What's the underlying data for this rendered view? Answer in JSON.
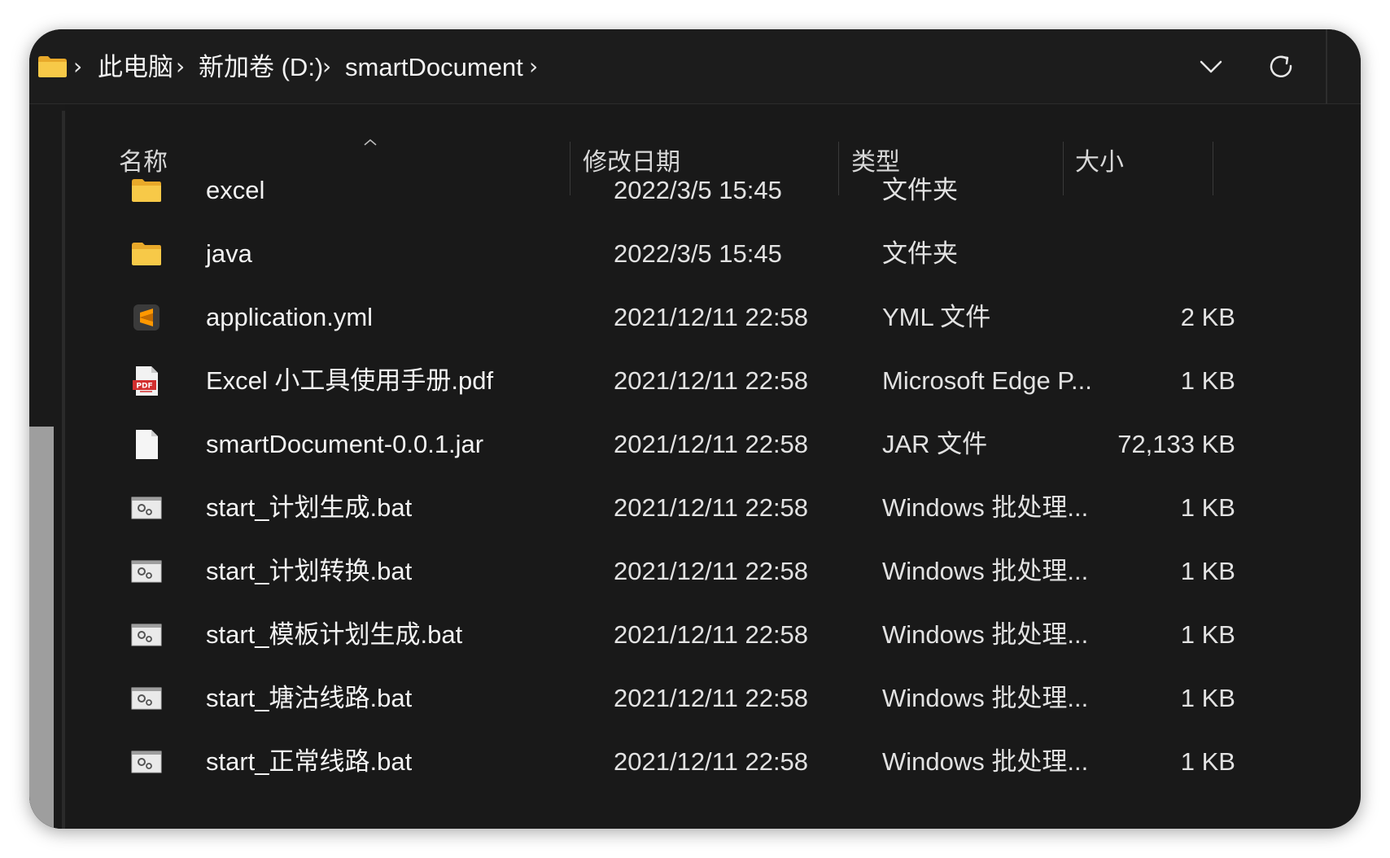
{
  "breadcrumb": {
    "items": [
      "此电脑",
      "新加卷 (D:)",
      "smartDocument"
    ]
  },
  "columns": {
    "name": "名称",
    "date": "修改日期",
    "type": "类型",
    "size": "大小"
  },
  "files": [
    {
      "name": "excel",
      "date": "2022/3/5 15:45",
      "type": "文件夹",
      "size": "",
      "icon": "folder-icon"
    },
    {
      "name": "java",
      "date": "2022/3/5 15:45",
      "type": "文件夹",
      "size": "",
      "icon": "folder-icon"
    },
    {
      "name": "application.yml",
      "date": "2021/12/11 22:58",
      "type": "YML 文件",
      "size": "2 KB",
      "icon": "sublime-text-icon"
    },
    {
      "name": "Excel 小工具使用手册.pdf",
      "date": "2021/12/11 22:58",
      "type": "Microsoft Edge P...",
      "size": "1 KB",
      "icon": "pdf-icon"
    },
    {
      "name": "smartDocument-0.0.1.jar",
      "date": "2021/12/11 22:58",
      "type": "JAR 文件",
      "size": "72,133 KB",
      "icon": "blank-file-icon"
    },
    {
      "name": "start_计划生成.bat",
      "date": "2021/12/11 22:58",
      "type": "Windows 批处理...",
      "size": "1 KB",
      "icon": "batch-file-icon"
    },
    {
      "name": "start_计划转换.bat",
      "date": "2021/12/11 22:58",
      "type": "Windows 批处理...",
      "size": "1 KB",
      "icon": "batch-file-icon"
    },
    {
      "name": "start_模板计划生成.bat",
      "date": "2021/12/11 22:58",
      "type": "Windows 批处理...",
      "size": "1 KB",
      "icon": "batch-file-icon"
    },
    {
      "name": "start_塘沽线路.bat",
      "date": "2021/12/11 22:58",
      "type": "Windows 批处理...",
      "size": "1 KB",
      "icon": "batch-file-icon"
    },
    {
      "name": "start_正常线路.bat",
      "date": "2021/12/11 22:58",
      "type": "Windows 批处理...",
      "size": "1 KB",
      "icon": "batch-file-icon"
    }
  ],
  "colors": {
    "background": "#191919",
    "text": "#f2f2f2",
    "folder": "#f7c948",
    "scroll_thumb": "#9e9e9e"
  }
}
